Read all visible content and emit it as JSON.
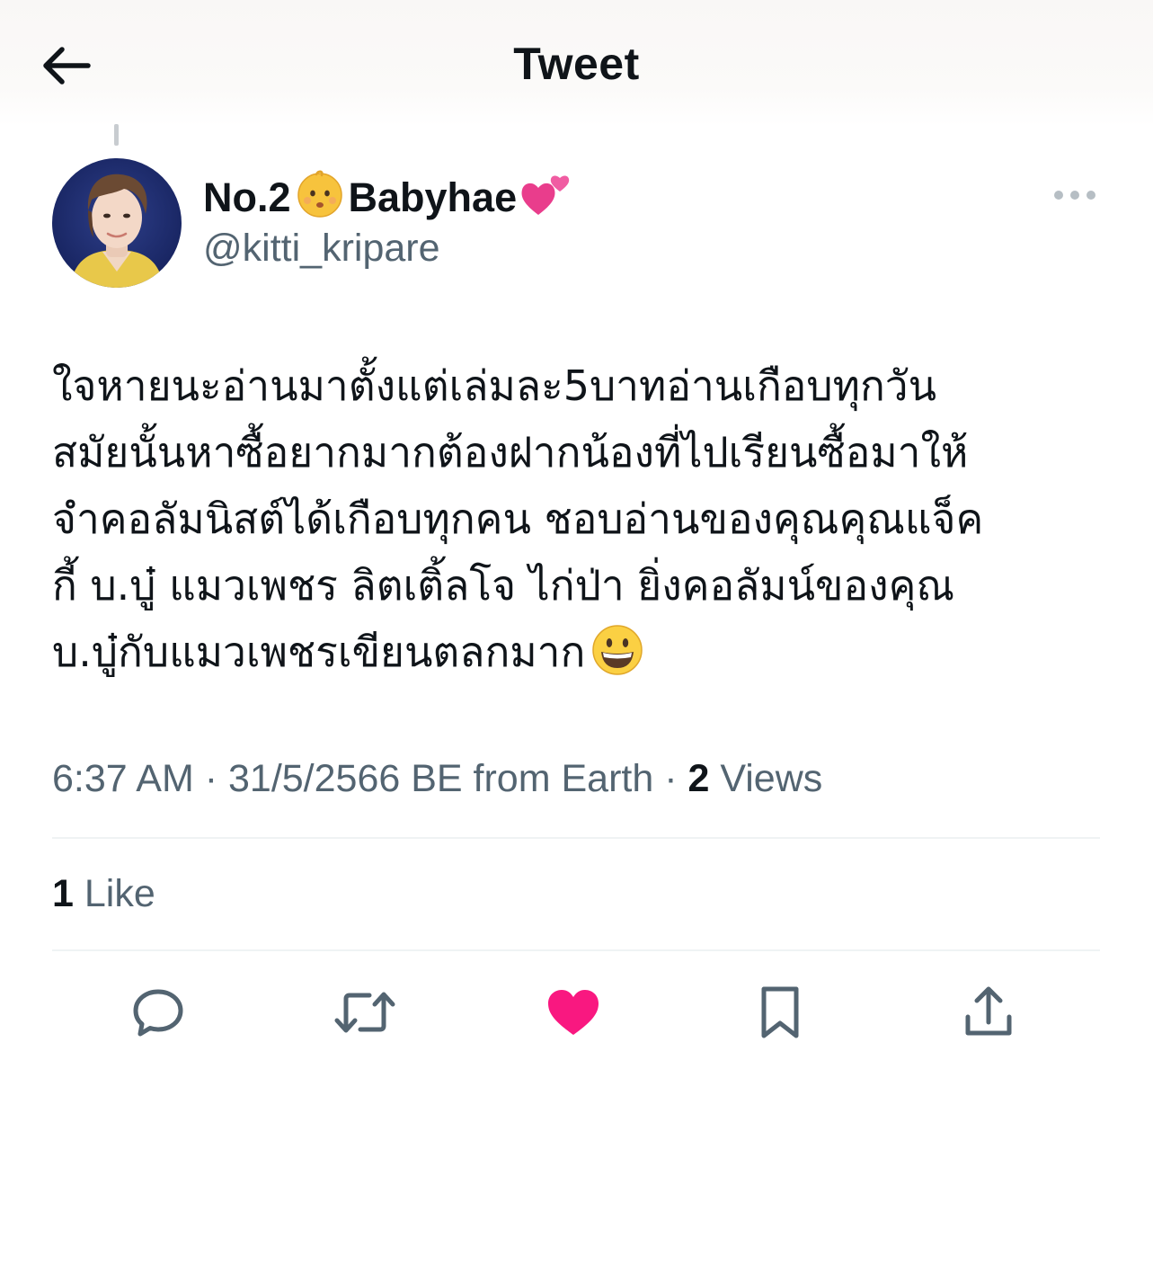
{
  "header": {
    "title": "Tweet",
    "back_icon": "arrow-left-icon"
  },
  "author": {
    "name": "No.2",
    "name_emoji_1": "👶",
    "name_suffix": "Babyhae",
    "name_emoji_2": "💕",
    "handle": "@kitti_kripare"
  },
  "tweet": {
    "lines": [
      "ใจหายนะอ่านมาตั้งแต่เล่มละ5บาทอ่านเกือบทุกวัน",
      "สมัยนั้นหาซื้อยากมากต้องฝากน้องที่ไปเรียนซื้อมาให้",
      "จำคอลัมนิสต์ได้เกือบทุกคน ชอบอ่านของคุณคุณแจ็ค",
      "กี้ บ.บู๋ แมวเพชร ลิตเติ้ลโจ ไก่ป่า ยิ่งคอลัมน์ของคุณ",
      "บ.บู๋กับแมวเพชรเขียนตลกมาก"
    ],
    "end_emoji": "grinning-face-icon"
  },
  "meta": {
    "time": "6:37 AM",
    "sep1": " · ",
    "date": "31/5/2566 BE",
    "source": " from Earth",
    "sep2": " · ",
    "views_count": "2",
    "views_label": " Views"
  },
  "stats": {
    "likes_count": "1",
    "likes_label": " Like"
  },
  "actions": [
    "reply-icon",
    "retweet-icon",
    "like-icon",
    "bookmark-icon",
    "share-icon"
  ],
  "colors": {
    "text": "#0f1419",
    "secondary": "#536471",
    "divider": "#eff3f4",
    "like": "#f91880"
  }
}
